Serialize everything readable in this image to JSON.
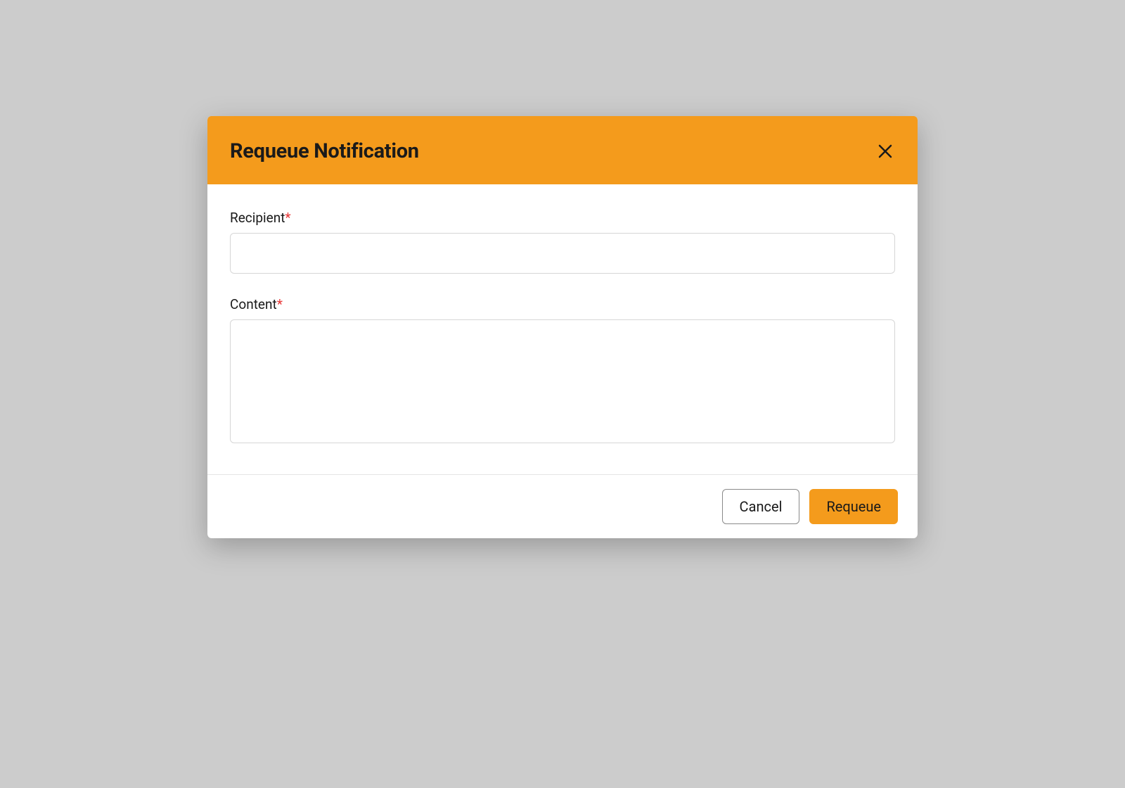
{
  "modal": {
    "title": "Requeue Notification",
    "fields": {
      "recipient": {
        "label": "Recipient",
        "required_mark": "*",
        "value": ""
      },
      "content": {
        "label": "Content",
        "required_mark": "*",
        "value": ""
      }
    },
    "buttons": {
      "cancel": "Cancel",
      "requeue": "Requeue"
    }
  }
}
